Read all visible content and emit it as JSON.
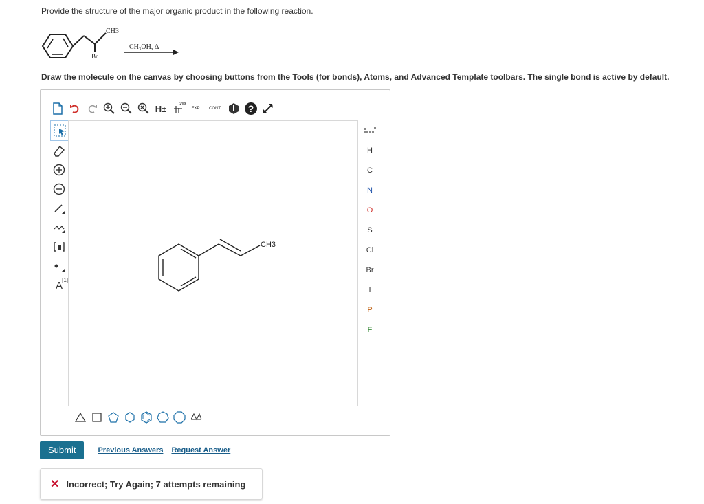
{
  "question": {
    "text": "Provide the structure of the major organic product in the following reaction."
  },
  "reaction": {
    "substituent_label": "CH3",
    "halogen_label": "Br",
    "reagent": "CH₃OH, Δ"
  },
  "instruction": {
    "text": "Draw the molecule on the canvas by choosing buttons from the Tools (for bonds), Atoms, and Advanced Template toolbars. The single bond is active by default."
  },
  "toolbar": {
    "h_label": "H±",
    "twod_label": "2D",
    "exp_label": "EXP.",
    "cont_label": "CONT.",
    "charge_label": "[1]",
    "atom_a_label": "A"
  },
  "canvas": {
    "methyl_label": "CH3"
  },
  "atoms": [
    "H",
    "C",
    "N",
    "O",
    "S",
    "Cl",
    "Br",
    "I",
    "P",
    "F"
  ],
  "colors": {
    "submit_bg": "#1a7090",
    "link": "#1a5e8a",
    "error": "#c8102e",
    "oxygen": "#d0302b",
    "halogen": "#333333"
  },
  "actions": {
    "submit_label": "Submit",
    "previous_answers_label": "Previous Answers",
    "request_answer_label": "Request Answer"
  },
  "feedback": {
    "icon": "x-icon",
    "text": "Incorrect; Try Again; 7 attempts remaining"
  }
}
